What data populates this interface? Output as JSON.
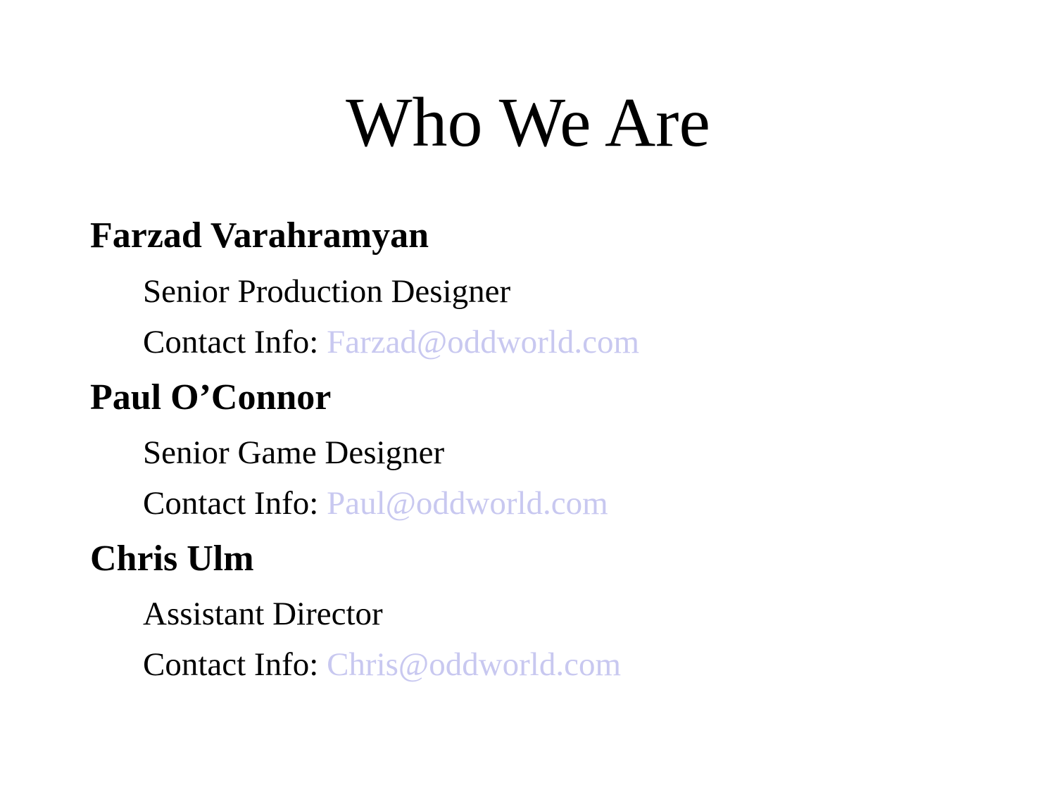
{
  "slide": {
    "title": "Who We Are",
    "email_color": "#c8c8f0",
    "people": [
      {
        "name": "Farzad Varahramyan",
        "role": "Senior Production Designer",
        "contact_label": "Contact Info: ",
        "email": "Farzad@oddworld.com"
      },
      {
        "name": "Paul O’Connor",
        "role": "Senior Game Designer",
        "contact_label": "Contact Info: ",
        "email": "Paul@oddworld.com"
      },
      {
        "name": "Chris Ulm",
        "role": "Assistant Director",
        "contact_label": "Contact Info: ",
        "email": "Chris@oddworld.com"
      }
    ]
  }
}
